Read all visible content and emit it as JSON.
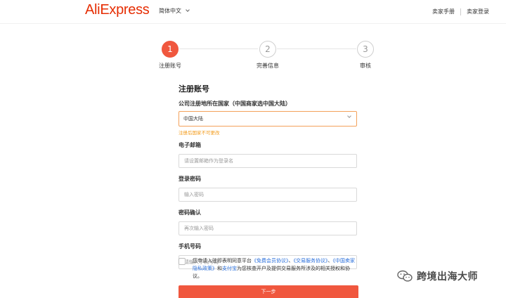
{
  "header": {
    "logo": "AliExpress",
    "language": "简体中文",
    "links": [
      "卖家手册",
      "卖家登录"
    ]
  },
  "steps": [
    {
      "number": "1",
      "label": "注册账号",
      "active": true
    },
    {
      "number": "2",
      "label": "完善信息",
      "active": false
    },
    {
      "number": "3",
      "label": "审核",
      "active": false
    }
  ],
  "form": {
    "title": "注册账号",
    "country": {
      "label": "公司注册地所在国家（中国商家选中国大陆）",
      "value": "中国大陆",
      "hint": "注册后国家不可更改"
    },
    "email": {
      "label": "电子邮箱",
      "placeholder": "请设置邮箱作为登录名"
    },
    "password": {
      "label": "登录密码",
      "placeholder": "输入密码"
    },
    "confirm": {
      "label": "密码确认",
      "placeholder": "再次输入密码"
    },
    "phone": {
      "label": "手机号码",
      "placeholder": "请输入手机号码"
    },
    "agreement": {
      "prefix": "您申请入驻即表明同意平台",
      "link1": "《免费会员协议》",
      "sep1": "、",
      "link2": "《交易服务协议》",
      "sep2": "、",
      "link3": "《中国卖家隐私政策》",
      "mid": "和",
      "link4": "支付宝",
      "suffix": "为您核查开户及提供交易服务所涉及的相关授权和协议。"
    },
    "next": "下一步"
  },
  "watermark": "跨境出海大师",
  "colors": {
    "brand": "#e62e04",
    "accent": "#f0573e",
    "hint": "#f39b1a",
    "link": "#2a6fdb"
  }
}
